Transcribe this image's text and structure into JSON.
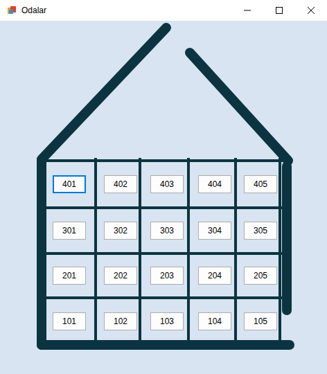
{
  "window": {
    "title": "Odalar"
  },
  "floors": [
    {
      "rooms": [
        {
          "label": "401",
          "focused": true
        },
        {
          "label": "402",
          "focused": false
        },
        {
          "label": "403",
          "focused": false
        },
        {
          "label": "404",
          "focused": false
        },
        {
          "label": "405",
          "focused": false
        }
      ]
    },
    {
      "rooms": [
        {
          "label": "301",
          "focused": false
        },
        {
          "label": "302",
          "focused": false
        },
        {
          "label": "303",
          "focused": false
        },
        {
          "label": "304",
          "focused": false
        },
        {
          "label": "305",
          "focused": false
        }
      ]
    },
    {
      "rooms": [
        {
          "label": "201",
          "focused": false
        },
        {
          "label": "202",
          "focused": false
        },
        {
          "label": "203",
          "focused": false
        },
        {
          "label": "204",
          "focused": false
        },
        {
          "label": "205",
          "focused": false
        }
      ]
    },
    {
      "rooms": [
        {
          "label": "101",
          "focused": false
        },
        {
          "label": "102",
          "focused": false
        },
        {
          "label": "103",
          "focused": false
        },
        {
          "label": "104",
          "focused": false
        },
        {
          "label": "105",
          "focused": false
        }
      ]
    }
  ]
}
